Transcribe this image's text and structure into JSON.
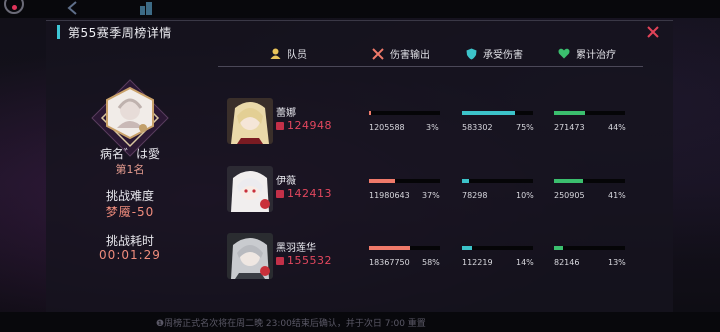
{
  "title": "第55赛季周榜详情",
  "player": {
    "name": "病名゛は愛",
    "rank": "第1名"
  },
  "difficulty": {
    "label": "挑战难度",
    "value": "梦魇-50"
  },
  "time": {
    "label": "挑战耗时",
    "value": "00:01:29"
  },
  "headers": {
    "member": "队员",
    "damage": "伤害输出",
    "taken": "承受伤害",
    "heal": "累计治疗"
  },
  "icons": {
    "member": "user-icon",
    "damage": "crossed-swords-icon",
    "taken": "shield-icon",
    "heal": "heart-icon",
    "close": "close-icon"
  },
  "colors": {
    "accent": "#3ec7d6",
    "damage": "#f07a6a",
    "taken": "#3cc3c9",
    "heal": "#3bbf6e",
    "score": "#e2475e",
    "close": "#e24358"
  },
  "members": [
    {
      "name": "蕾娜",
      "score": "124948",
      "damage": {
        "value": "1205588",
        "percent": "3%",
        "fraction": 0.03
      },
      "taken": {
        "value": "583302",
        "percent": "75%",
        "fraction": 0.75
      },
      "heal": {
        "value": "271473",
        "percent": "44%",
        "fraction": 0.44
      }
    },
    {
      "name": "伊薇",
      "score": "142413",
      "damage": {
        "value": "11980643",
        "percent": "37%",
        "fraction": 0.37
      },
      "taken": {
        "value": "78298",
        "percent": "10%",
        "fraction": 0.1
      },
      "heal": {
        "value": "250905",
        "percent": "41%",
        "fraction": 0.41
      }
    },
    {
      "name": "黑羽莲华",
      "score": "155532",
      "damage": {
        "value": "18367750",
        "percent": "58%",
        "fraction": 0.58
      },
      "taken": {
        "value": "112219",
        "percent": "14%",
        "fraction": 0.14
      },
      "heal": {
        "value": "82146",
        "percent": "13%",
        "fraction": 0.13
      }
    }
  ],
  "notice": "❶周榜正式名次将在周二晚 23:00结束后确认，并于次日 7:00 重置"
}
